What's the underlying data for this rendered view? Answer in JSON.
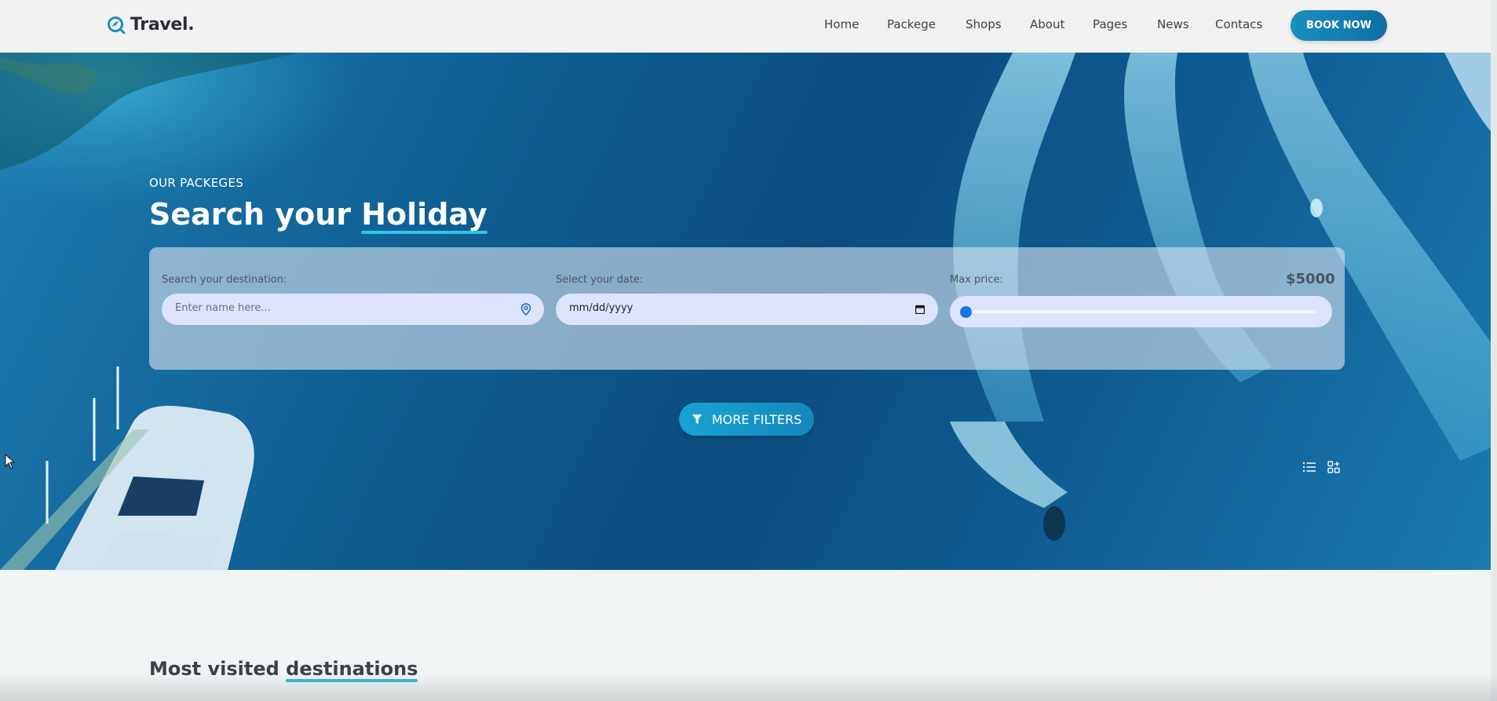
{
  "brand": {
    "name": "Travel.",
    "accent": "#1587bd"
  },
  "nav": {
    "items": [
      {
        "label": "Home"
      },
      {
        "label": "Packege"
      },
      {
        "label": "Shops"
      },
      {
        "label": "About"
      },
      {
        "label": "Pages"
      },
      {
        "label": "News"
      },
      {
        "label": "Contacs"
      }
    ],
    "cta_label": "BOOK NOW"
  },
  "hero": {
    "eyebrow": "OUR PACKEGES",
    "title_part1": "Search your ",
    "title_highlight": "Holiday"
  },
  "search": {
    "destination": {
      "label": "Search your destination:",
      "placeholder": "Enter name here..."
    },
    "date": {
      "label": "Select your date:",
      "value": "mm/dd/yyyy"
    },
    "price": {
      "label": "Max price:",
      "value": "$5000",
      "slider_fraction": 0.0
    },
    "more_filters_label": "MORE FILTERS"
  },
  "social_icons": [
    "facebook-icon",
    "instagram-icon",
    "tripadvisor-icon"
  ],
  "view_icons": [
    "list-view-icon",
    "grid-view-icon"
  ],
  "section": {
    "title_part1": "Most visited ",
    "title_highlight": "destinations"
  }
}
